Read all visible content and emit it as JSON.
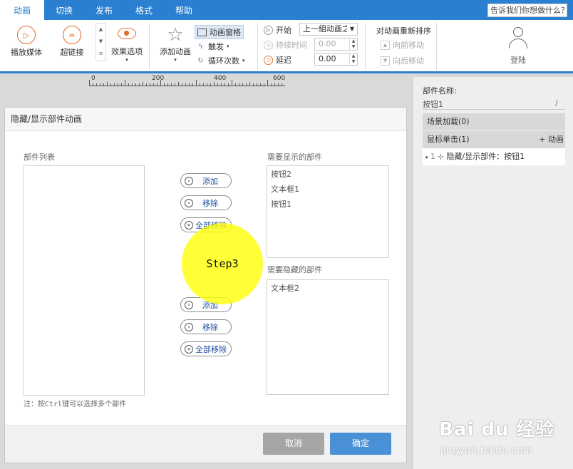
{
  "tabs": [
    "动画",
    "切换",
    "发布",
    "格式",
    "帮助"
  ],
  "tell_me": "告诉我们你想做什么？",
  "ribbon": {
    "play_media": "播放媒体",
    "hyperlink": "超链接",
    "effect_options": "效果选项",
    "add_animation": "添加动画",
    "animation_pane": "动画窗格",
    "trigger": "触发",
    "loop_count": "循环次数",
    "start_label": "开始",
    "start_value": "上一組动画之",
    "duration_label": "持续时间",
    "duration_value": "0.00",
    "delay_label": "延迟",
    "delay_value": "0.00",
    "reorder_title": "对动画重新排序",
    "move_earlier": "向前移动",
    "move_later": "向后移动",
    "login": "登陆"
  },
  "ruler": [
    "0",
    "200",
    "400",
    "600"
  ],
  "dialog": {
    "title": "隐藏/显示部件动画",
    "components_label": "部件列表",
    "show_label": "需要显示的部件",
    "hide_label": "需要隐藏的部件",
    "show_items": [
      "按钮2",
      "文本框1",
      "按钮1"
    ],
    "hide_items": [
      "文本框2"
    ],
    "add": "添加",
    "remove": "移除",
    "remove_all": "全部移除",
    "note": "注：按Ctrl键可以选择多个部件",
    "cancel": "取消",
    "ok": "确定"
  },
  "step_label": "Step3",
  "panel": {
    "name_label": "部件名称:",
    "name_value": "按钮1",
    "scene_load": "场景加载(0)",
    "mouse_click": "鼠标单击(1)",
    "add_anim": "+ 动画",
    "row_index": "1",
    "row_text": "隐藏/显示部件：按钮1"
  },
  "watermark": {
    "logo": "Bai du 经验",
    "url": "jingyan.baidu.com"
  },
  "colors": {
    "accent": "#2b7fd0",
    "cancel": "#a6a6a6",
    "ok": "#4a90d6",
    "step": "#ffff00"
  }
}
